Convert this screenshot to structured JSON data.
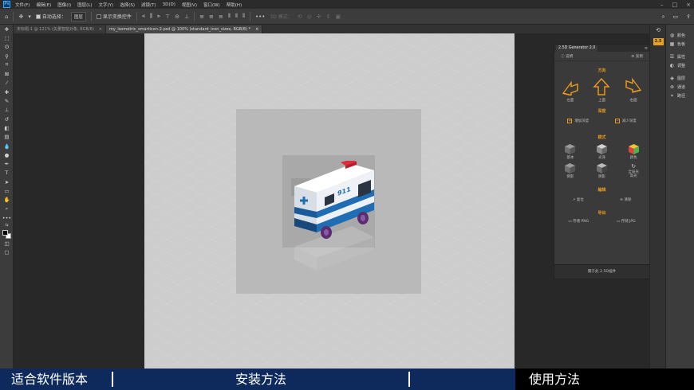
{
  "menubar": {
    "items": [
      "文件(F)",
      "编辑(E)",
      "图像(I)",
      "图层(L)",
      "文字(Y)",
      "选择(S)",
      "滤镜(T)",
      "3D(D)",
      "视图(V)",
      "窗口(W)",
      "帮助(H)"
    ]
  },
  "options": {
    "auto_select_label": "自动选择：",
    "layer_select": "图层",
    "show_transform_label": "显示变换控件",
    "mode_label": "3D 模式："
  },
  "tabs": [
    {
      "label": "未标题-1 @ 121% (矢量智能对象, RGB/8)",
      "close": "×"
    },
    {
      "label": "my_isometric_smarticon-2.psd @ 100% (standard_icon_sizes, RGB/8) *",
      "close": "×"
    }
  ],
  "panel": {
    "tab_title": "2.5D Generator 2.0",
    "menu_glyph": "≡",
    "help_label": "说明",
    "settings_label": "案例",
    "direction_title": "方向",
    "arrows": [
      "左面",
      "上面",
      "右面"
    ],
    "depth_title": "深度",
    "increase_depth": "增加深度",
    "decrease_depth": "减少深度",
    "mode_title": "模式",
    "modes": [
      "基本",
      "光泽",
      "颜色",
      "倒影",
      "阴影",
      "全局光\n高光"
    ],
    "edit_title": "编辑",
    "reset_label": "复位",
    "clear_label": "清除",
    "export_title": "导出",
    "save_png": "存储 PNG",
    "save_jpg": "存储 JPG",
    "footer": "關于此 2.5D插件"
  },
  "side": {
    "badge": "2.5"
  },
  "right_panel": {
    "items": [
      "颜色",
      "色板",
      "属性",
      "调整",
      "图层",
      "通道",
      "路径"
    ]
  },
  "banner": {
    "left": "适合软件版本",
    "middle": "安装方法",
    "right": "使用方法"
  },
  "colors": {
    "accent": "#e89a1b",
    "banner_bg": "#0e2a5c",
    "ps_blue": "#31a8ff"
  }
}
